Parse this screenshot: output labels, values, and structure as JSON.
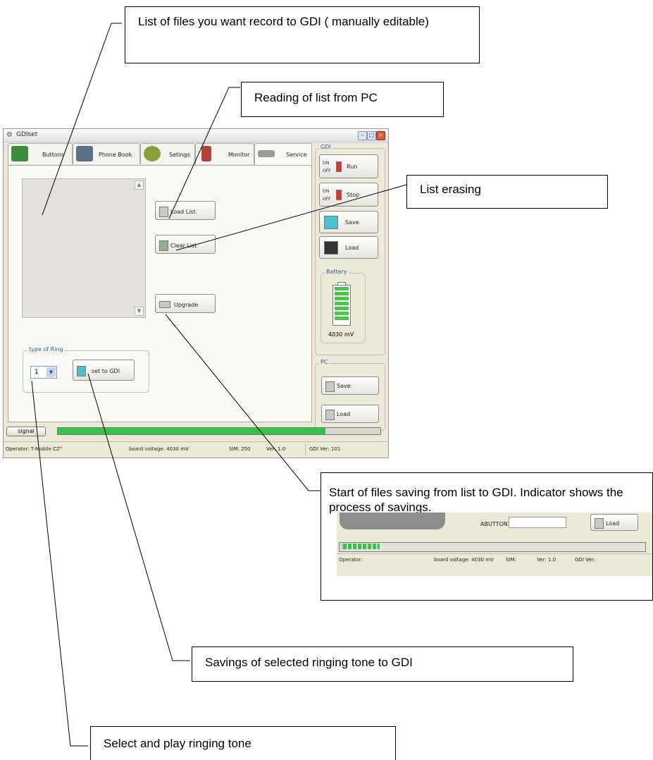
{
  "callouts": {
    "file_list": "List of files you want record to GDI ( manually editable)",
    "reading_list": "Reading of list from PC",
    "list_erasing": "List erasing",
    "start_saving": "Start of files saving from list to GDI. Indicator shows the process of savings.",
    "save_ring": "Savings of selected ringing tone to GDI",
    "select_ring": "Select and play ringing tone"
  },
  "window": {
    "title": "GDIset",
    "controls": {
      "minimize": "–",
      "maximize": "□",
      "close": "×"
    }
  },
  "tabs": [
    {
      "label": "Buttons",
      "icon": "buttons-icon"
    },
    {
      "label": "Phone Book",
      "icon": "phone-book-icon"
    },
    {
      "label": "Setings",
      "icon": "settings-icon"
    },
    {
      "label": "Monitor",
      "icon": "monitor-icon"
    },
    {
      "label": "Service",
      "icon": "chip-icon",
      "active": true
    }
  ],
  "service": {
    "load_list": "Load List",
    "clear_list": "Clear List",
    "upgrade": "Upgrade",
    "ring_group_title": "type of Ring",
    "ring_value": "1",
    "set_to_gdi": "set to GDI"
  },
  "side": {
    "gdi_title": "GDI",
    "run": "Run",
    "stop": "Stop",
    "on": "ON",
    "off": "OFF",
    "save": "Save",
    "load": "Load",
    "battery_title": "Battery",
    "battery_value": "4030 mV",
    "pc_title": "PC",
    "pc_save": "Save",
    "pc_load": "Load"
  },
  "status": {
    "signal": "signal",
    "progress": 0.83,
    "operator": "Operator: T-Mobile CZ°",
    "board_voltage": "board voltage: 4030 mV",
    "sim": "SIM: 250",
    "ver": "Ver: 1.0",
    "gdi_ver": "GDI Ver: 101"
  },
  "inset": {
    "abutton": "ABUTTON7",
    "load": "Load",
    "progress": 0.12,
    "operator": "Operator:",
    "board_voltage": "board voltage: 4030 mV",
    "sim": "SIM:",
    "ver": "Ver: 1.0",
    "gdi_ver": "GDI Ver:"
  },
  "colors": {
    "accent": "#2c5aa0",
    "progress_green": "#33c24a",
    "window_bg": "#ece9d8"
  }
}
